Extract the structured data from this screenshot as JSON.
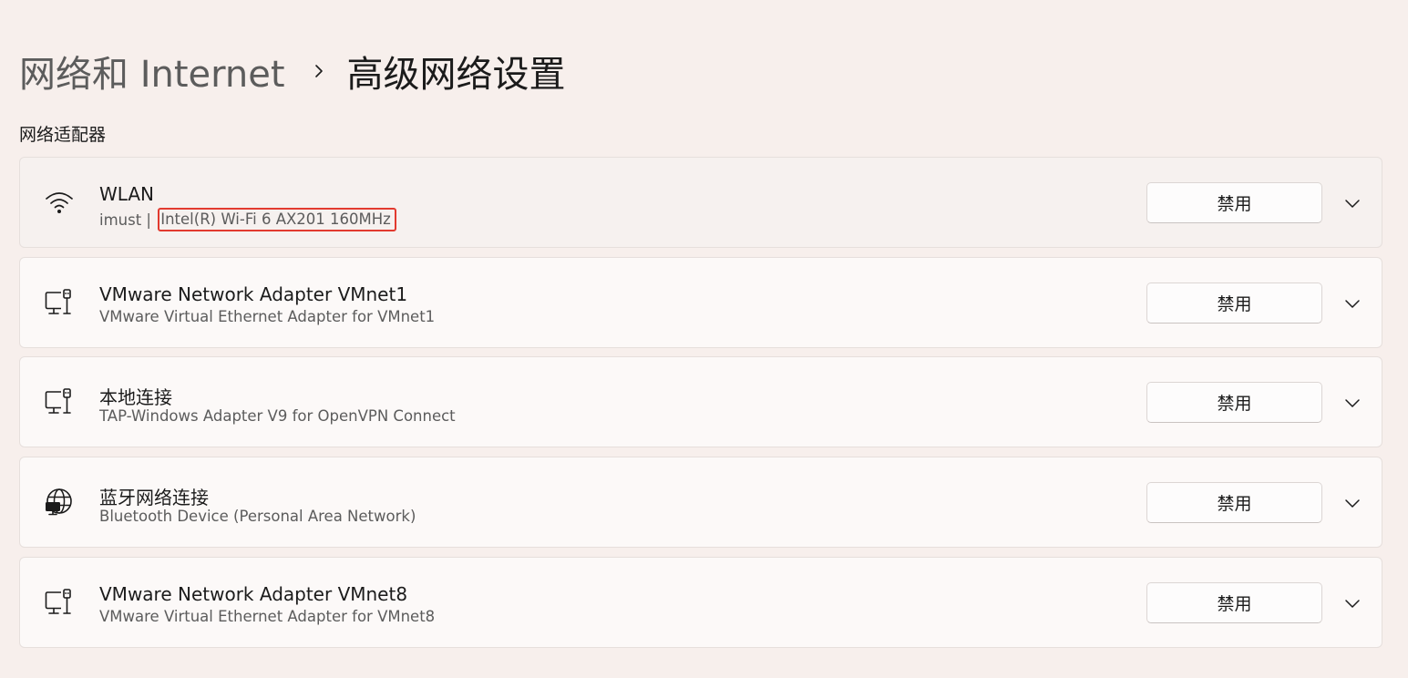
{
  "breadcrumb": {
    "parent": "网络和 Internet",
    "separator_icon": "chevron-right-icon",
    "current": "高级网络设置"
  },
  "section": {
    "title": "网络适配器"
  },
  "adapters": [
    {
      "icon": "wifi-icon",
      "name": "WLAN",
      "sub_prefix": "imust | ",
      "description": "Intel(R) Wi-Fi 6 AX201 160MHz",
      "button": "禁用",
      "highlighted": true
    },
    {
      "icon": "ethernet-adapter-icon",
      "name": "VMware Network Adapter VMnet1",
      "sub_prefix": "",
      "description": "VMware Virtual Ethernet Adapter for VMnet1",
      "button": "禁用"
    },
    {
      "icon": "ethernet-adapter-icon",
      "name": "本地连接",
      "sub_prefix": "",
      "description": "TAP-Windows Adapter V9 for OpenVPN Connect",
      "button": "禁用"
    },
    {
      "icon": "globe-network-icon",
      "name": "蓝牙网络连接",
      "sub_prefix": "",
      "description": "Bluetooth Device (Personal Area Network)",
      "button": "禁用"
    },
    {
      "icon": "ethernet-adapter-icon",
      "name": "VMware Network Adapter VMnet8",
      "sub_prefix": "",
      "description": "VMware Virtual Ethernet Adapter for VMnet8",
      "button": "禁用"
    }
  ],
  "colors": {
    "background": "#f7efec",
    "card": "#fcf9f8",
    "highlight_border": "#e23a2f"
  }
}
